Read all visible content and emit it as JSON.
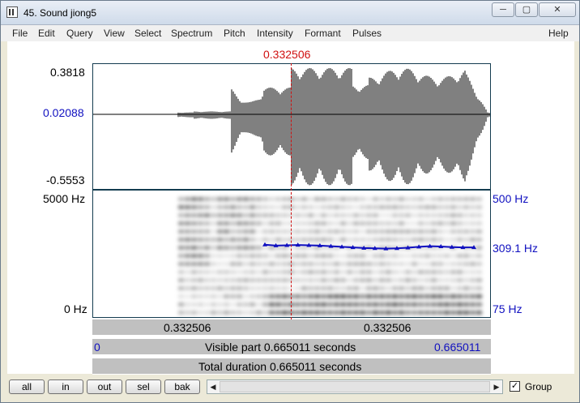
{
  "window": {
    "title": "45. Sound jiong5",
    "min_icon": "minimize-icon",
    "max_icon": "maximize-icon",
    "close_icon": "close-icon"
  },
  "menu": [
    "File",
    "Edit",
    "Query",
    "View",
    "Select",
    "Spectrum",
    "Pitch",
    "Intensity",
    "Formant",
    "Pulses"
  ],
  "menu_help": "Help",
  "cursor_time": "0.332506",
  "waveform": {
    "max": "0.3818",
    "cursor_value": "0.02088",
    "min": "-0.5553"
  },
  "spectrogram": {
    "fmax": "5000 Hz",
    "fmin": "0 Hz"
  },
  "pitch": {
    "max": "500 Hz",
    "current": "309.1 Hz",
    "min": "75 Hz",
    "contour_hz": [
      318,
      315,
      316,
      317,
      316,
      315,
      313,
      311,
      309,
      307,
      306,
      305,
      306,
      308,
      311,
      313,
      312,
      310,
      309,
      309
    ]
  },
  "selection_bar": {
    "left": "0.332506",
    "right": "0.332506"
  },
  "visible_bar": {
    "start": "0",
    "text": "Visible part 0.665011 seconds",
    "end": "0.665011"
  },
  "total_bar": {
    "text": "Total duration 0.665011 seconds"
  },
  "buttons": [
    "all",
    "in",
    "out",
    "sel",
    "bak"
  ],
  "group_label": "Group",
  "group_checked": true,
  "colors": {
    "cursor": "#d01010",
    "pitch": "#1010c0",
    "frame": "#143c50"
  }
}
